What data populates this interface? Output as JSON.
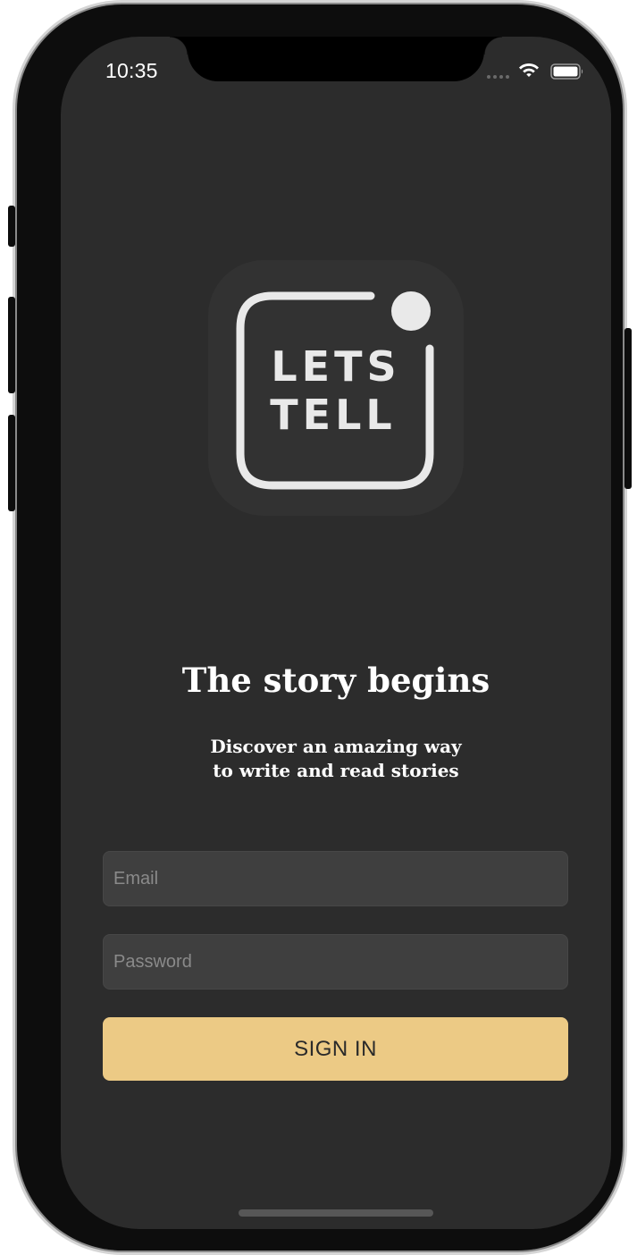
{
  "status_bar": {
    "time": "10:35",
    "signal_icon": "signal-dots-icon",
    "wifi_icon": "wifi-icon",
    "battery_icon": "battery-icon"
  },
  "logo": {
    "icon": "letstell-logo",
    "line1": "LETS",
    "line2": "TELL"
  },
  "headline": "The story begins",
  "subtitle": {
    "line1": "Discover an amazing way",
    "line2": "to write and read stories"
  },
  "form": {
    "email_placeholder": "Email",
    "email_value": "",
    "password_placeholder": "Password",
    "password_value": "",
    "submit_label": "SIGN IN"
  },
  "colors": {
    "background": "#2c2c2c",
    "field_background": "#3f3f3f",
    "accent": "#ecca85",
    "text": "#ffffff"
  }
}
